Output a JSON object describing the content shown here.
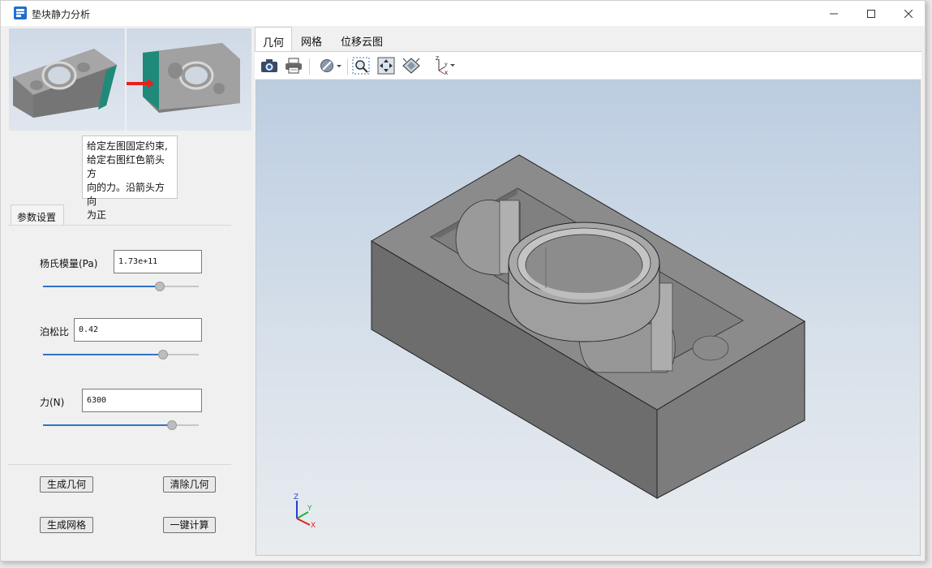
{
  "window": {
    "title": "垫块静力分析",
    "app_icon": "app-grid-icon",
    "controls": [
      "minimize-icon",
      "maximize-icon",
      "close-icon"
    ]
  },
  "left_panel": {
    "thumbnails": [
      "fixed-constraint-preview",
      "force-arrow-preview"
    ],
    "note_lines": [
      "给定左图固定约束,",
      "给定右图红色箭头方",
      "向的力。沿箭头方向",
      "为正"
    ],
    "settings_tab": "参数设置",
    "params": [
      {
        "label": "杨氏模量(Pa)",
        "value": "1.73e+11",
        "slider_fraction": 0.75
      },
      {
        "label": "泊松比",
        "value": "0.42",
        "slider_fraction": 0.77
      },
      {
        "label": "力(N)",
        "value": "6300",
        "slider_fraction": 0.83
      }
    ],
    "buttons": {
      "generate_geometry": "生成几何",
      "clear_geometry": "清除几何",
      "generate_mesh": "生成网格",
      "one_click_compute": "一键计算"
    }
  },
  "right_panel": {
    "tabs": [
      "几何",
      "网格",
      "位移云图"
    ],
    "active_tab": 0,
    "toolbar_icons": [
      "screenshot-camera-icon",
      "print-icon",
      "display-mode-icon",
      "zoom-box-icon",
      "fit-view-icon",
      "view-orientation-icon",
      "axis-triad-icon"
    ],
    "axis_labels": {
      "x": "X",
      "y": "Y",
      "z": "Z"
    }
  },
  "colors": {
    "accent": "#2f73c4",
    "force_arrow": "#e52020",
    "model_top": "#8c8c8c",
    "model_side": "#6c6c6c"
  }
}
